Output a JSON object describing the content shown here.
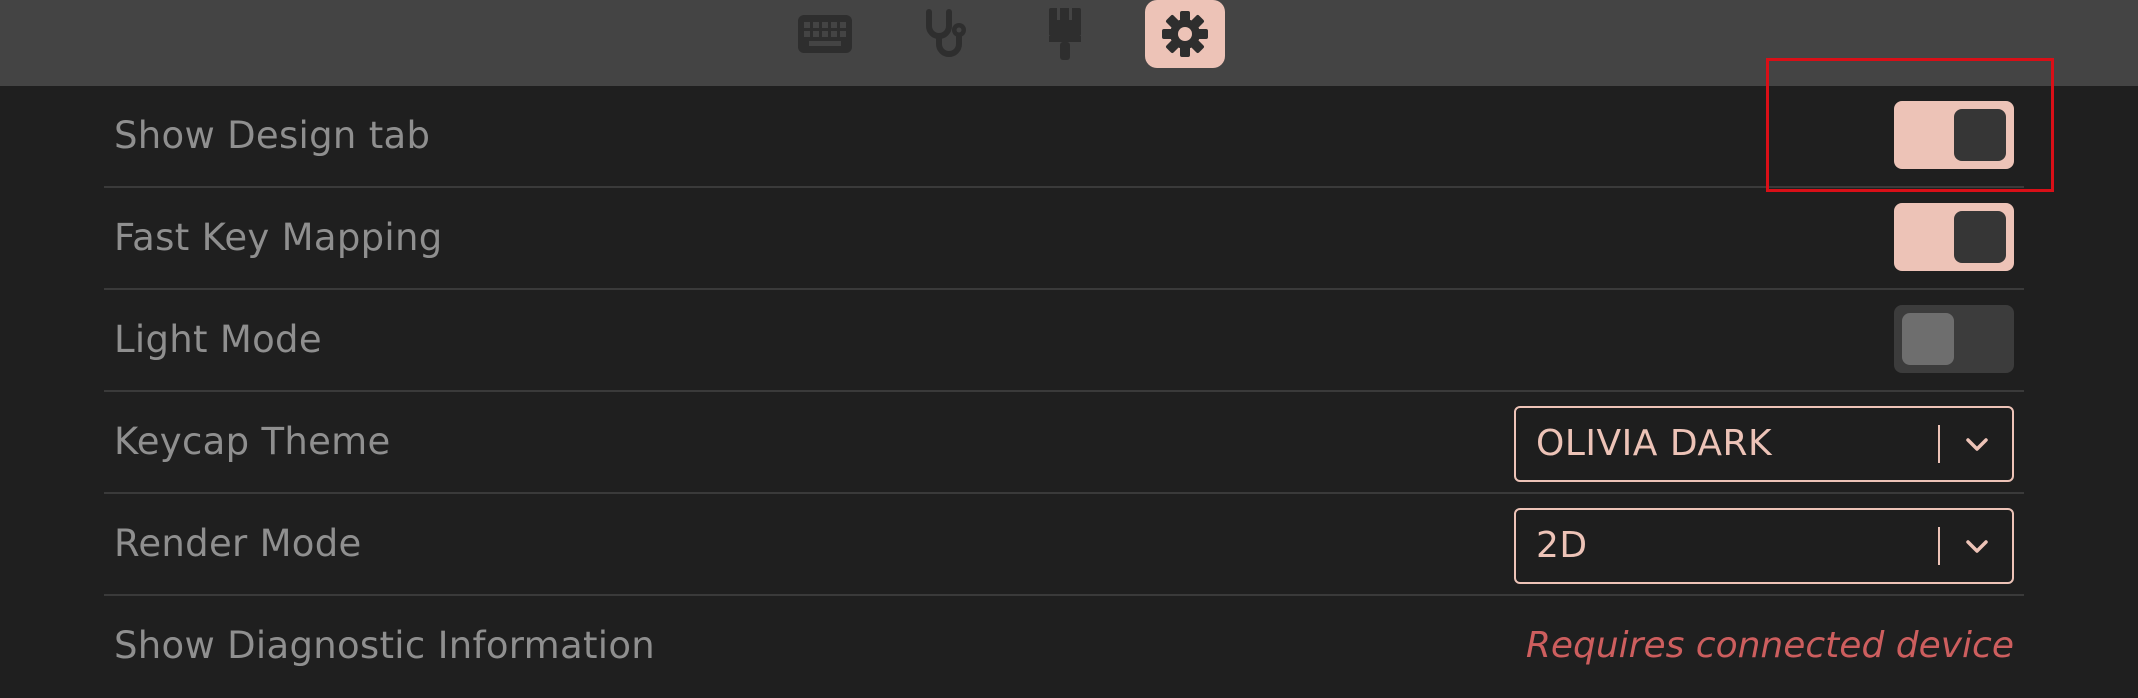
{
  "topbar": {
    "tabs": [
      {
        "icon": "keyboard-icon",
        "active": false
      },
      {
        "icon": "stethoscope-icon",
        "active": false
      },
      {
        "icon": "paintbrush-icon",
        "active": false
      },
      {
        "icon": "gear-icon",
        "active": true
      }
    ]
  },
  "settings": {
    "show_design_tab": {
      "label": "Show Design tab",
      "enabled": true
    },
    "fast_key_mapping": {
      "label": "Fast Key Mapping",
      "enabled": true
    },
    "light_mode": {
      "label": "Light Mode",
      "enabled": false
    },
    "keycap_theme": {
      "label": "Keycap Theme",
      "value": "OLIVIA DARK"
    },
    "render_mode": {
      "label": "Render Mode",
      "value": "2D"
    },
    "show_diagnostic_information": {
      "label": "Show Diagnostic Information",
      "status": "Requires connected device"
    }
  },
  "colors": {
    "accent": "#edc3b7",
    "background": "#1f1f1f",
    "topbar": "#444444",
    "warning": "#cd5e5e",
    "highlight": "#d90f17"
  }
}
